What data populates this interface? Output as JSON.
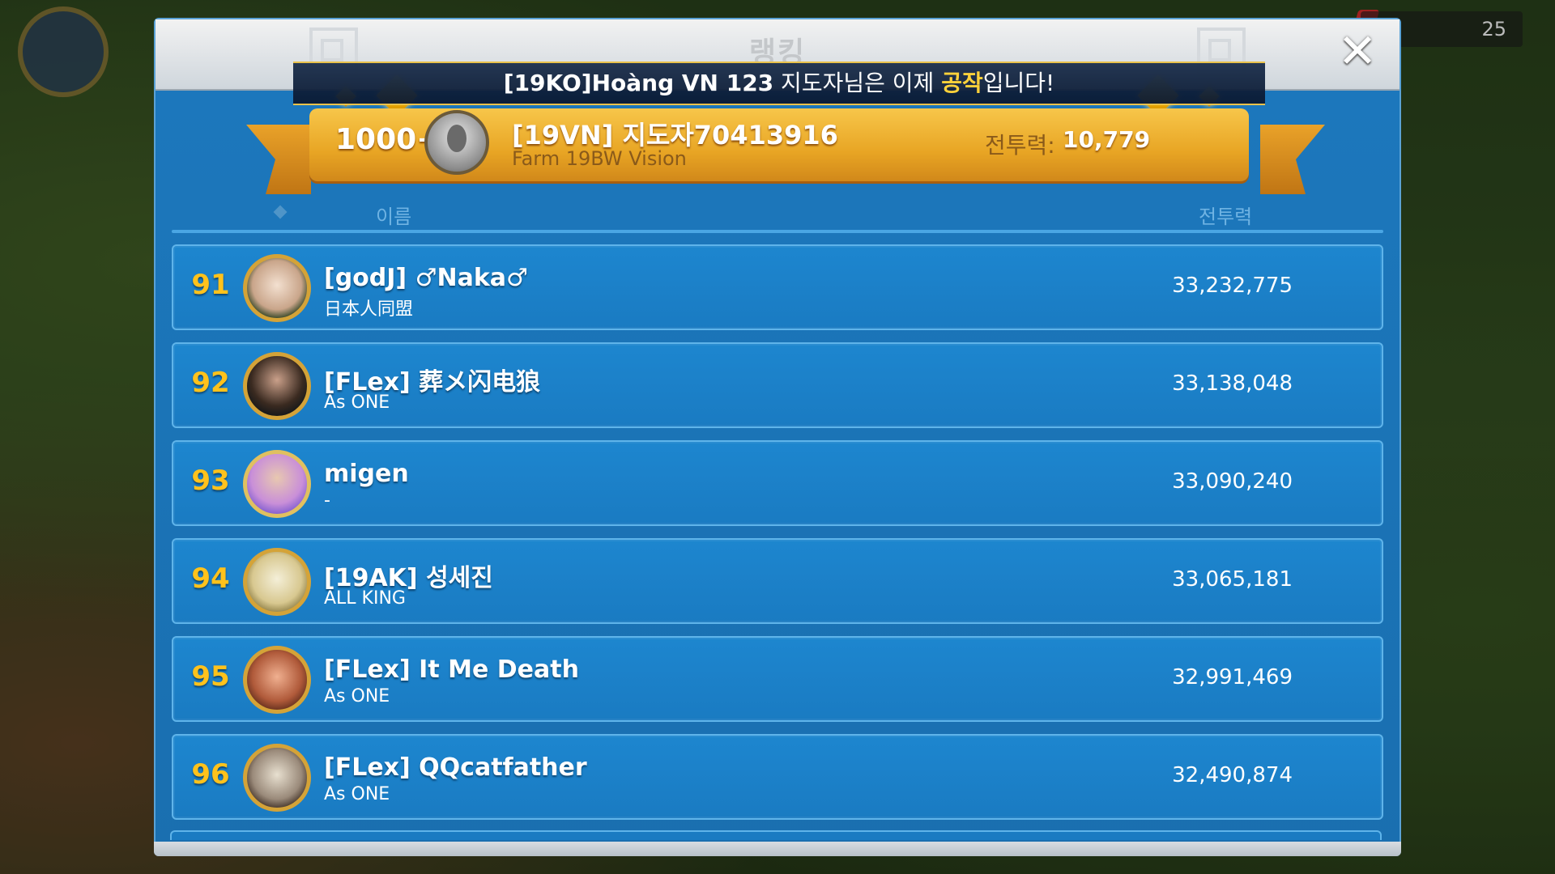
{
  "window": {
    "title": "랭킹"
  },
  "background": {
    "counter": "25"
  },
  "banner": {
    "player_name": "[19KO]Hoàng VN 123",
    "text_before": " 지도자님은 이제 ",
    "title": "공작",
    "text_after": "입니다!"
  },
  "my_entry": {
    "rank": "1000+",
    "name": "[19VN] 지도자70413916",
    "alliance": "Farm 19BW Vision",
    "power_label": "전투력:",
    "power_value": "10,779"
  },
  "columns": {
    "name": "이름",
    "power": "전투력"
  },
  "rows": [
    {
      "rank": "91",
      "name": "[godJ] ♂Naka♂",
      "alliance": "日本人同盟",
      "power": "33,232,775",
      "avatar_icon": "baby-portrait-avatar"
    },
    {
      "rank": "92",
      "name": "[FLex] 葬メ闪电狼",
      "alliance": "As ONE",
      "power": "33,138,048",
      "avatar_icon": "man-portrait-avatar"
    },
    {
      "rank": "93",
      "name": "migen",
      "alliance": "-",
      "power": "33,090,240",
      "avatar_icon": "winged-portrait-avatar"
    },
    {
      "rank": "94",
      "name": "[19AK] 성세진",
      "alliance": "ALL KING",
      "power": "33,065,181",
      "avatar_icon": "castle-portrait-avatar"
    },
    {
      "rank": "95",
      "name": "[FLex] It Me Death",
      "alliance": "As ONE",
      "power": "32,991,469",
      "avatar_icon": "warrior-portrait-avatar"
    },
    {
      "rank": "96",
      "name": "[FLex] QQcatfather",
      "alliance": "As ONE",
      "power": "32,490,874",
      "avatar_icon": "skull-portrait-avatar"
    }
  ],
  "colors": {
    "panel_blue": "#1c78bd",
    "rank_gold": "#ffc21c",
    "banner_highlight": "#ffd23a",
    "my_bar_gold": "#e8a524"
  }
}
